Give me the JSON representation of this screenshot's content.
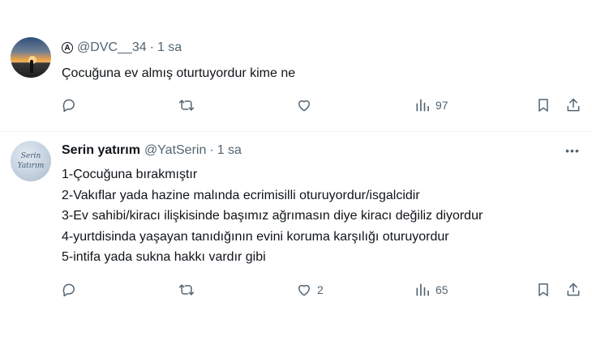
{
  "tweets": [
    {
      "avatar_icon": "sunset-silhouette-avatar",
      "name": "",
      "handle": "@DVC__34",
      "separator": "·",
      "time": "1 sa",
      "text_lines": [
        "Çocuğuna ev almış oturtuyordur kime ne"
      ],
      "replies": "",
      "retweets": "",
      "likes": "",
      "views": "97"
    },
    {
      "avatar_icon": "serin-yatirim-logo",
      "avatar_text": [
        "Serin",
        "Yatırım"
      ],
      "name": "Serin yatırım",
      "handle": "@YatSerin",
      "separator": "·",
      "time": "1 sa",
      "text_lines": [
        "1-Çocuğuna bırakmıştır",
        "2-Vakıflar yada hazine malında ecrimisilli oturuyordur/isgalcidir",
        "3-Ev sahibi/kiracı ilişkisinde başımız ağrımasın diye kiracı değiliz diyordur",
        "4-yurtdisinda yaşayan tanıdığının evini koruma karşılığı oturuyordur",
        "5-intifa yada sukna hakkı vardır gibi"
      ],
      "replies": "",
      "retweets": "",
      "likes": "2",
      "views": "65"
    }
  ],
  "colors": {
    "text": "#0f1419",
    "secondary": "#536471",
    "divider": "#eff3f4"
  }
}
